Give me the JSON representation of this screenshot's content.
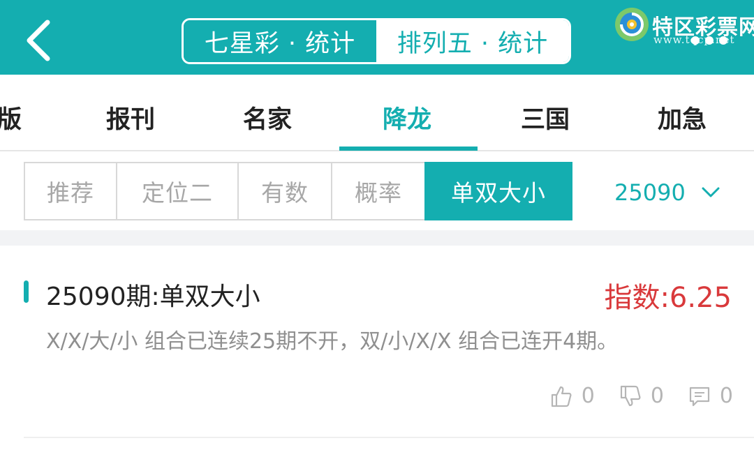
{
  "header": {
    "segments": [
      "七星彩 · 统计",
      "排列五 · 统计"
    ],
    "logo_text": "特区彩票网",
    "logo_sub": "www.tqcp.net",
    "colors": {
      "accent": "#14aeb0",
      "highlight": "#d9393b"
    }
  },
  "tabs": [
    "版",
    "报刊",
    "名家",
    "降龙",
    "三国",
    "加急"
  ],
  "subtabs": [
    "推荐",
    "定位二",
    "有数",
    "概率",
    "单双大小"
  ],
  "issue_select": {
    "value": "25090"
  },
  "card": {
    "title": "25090期:单双大小",
    "index": "指数:6.25",
    "description": "X/X/大/小 组合已连续25期不开，双/小/X/X 组合已连开4期。",
    "likes": "0",
    "dislikes": "0",
    "comments": "0"
  }
}
